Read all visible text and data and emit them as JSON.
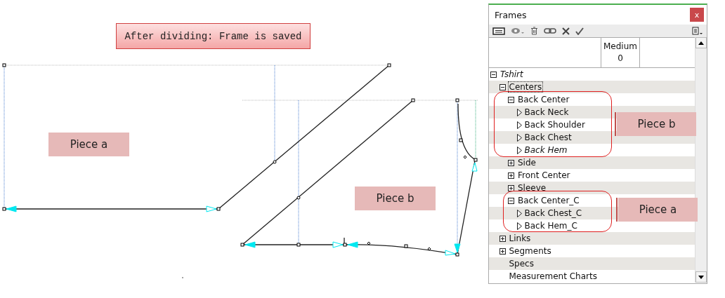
{
  "banner": {
    "text": "After dividing: Frame is saved"
  },
  "canvas": {
    "pieces": [
      {
        "label": "Piece a"
      },
      {
        "label": "Piece b"
      }
    ]
  },
  "panel": {
    "title": "Frames",
    "close_label": "x",
    "columns": [
      {
        "name": "Medium",
        "value": "0"
      }
    ],
    "tree": [
      {
        "label": "Tshirt",
        "kind": "group",
        "expanded": true,
        "italic": true,
        "selected": false,
        "children": [
          {
            "label": "Centers",
            "kind": "group",
            "expanded": true,
            "italic": false,
            "selected": true,
            "children": [
              {
                "label": "Back Center",
                "kind": "group",
                "expanded": true,
                "italic": false,
                "selected": false,
                "children": [
                  {
                    "label": "Back Neck",
                    "kind": "frame",
                    "italic": false,
                    "selected": false
                  },
                  {
                    "label": "Back Shoulder",
                    "kind": "frame",
                    "italic": false,
                    "selected": false
                  },
                  {
                    "label": "Back Chest",
                    "kind": "frame",
                    "italic": false,
                    "selected": false
                  },
                  {
                    "label": "Back Hem",
                    "kind": "frame",
                    "italic": true,
                    "selected": false
                  }
                ]
              },
              {
                "label": "Side",
                "kind": "group",
                "expanded": false,
                "italic": false,
                "selected": false
              },
              {
                "label": "Front Center",
                "kind": "group",
                "expanded": false,
                "italic": false,
                "selected": false
              },
              {
                "label": "Sleeve",
                "kind": "group",
                "expanded": false,
                "italic": false,
                "selected": false
              },
              {
                "label": "Back Center_C",
                "kind": "group",
                "expanded": true,
                "italic": false,
                "selected": false,
                "children": [
                  {
                    "label": "Back Chest_C",
                    "kind": "frame",
                    "italic": false,
                    "selected": false
                  },
                  {
                    "label": "Back Hem_C",
                    "kind": "frame",
                    "italic": false,
                    "selected": false
                  }
                ]
              }
            ]
          },
          {
            "label": "Links",
            "kind": "group",
            "expanded": false,
            "italic": false,
            "selected": false
          },
          {
            "label": "Segments",
            "kind": "group",
            "expanded": false,
            "italic": false,
            "selected": false
          },
          {
            "label": "Specs",
            "kind": "plain",
            "italic": false,
            "selected": false
          },
          {
            "label": "Measurement Charts",
            "kind": "plain",
            "italic": false,
            "selected": false
          }
        ]
      }
    ],
    "callouts": [
      {
        "label": "Piece b"
      },
      {
        "label": "Piece a"
      }
    ]
  }
}
